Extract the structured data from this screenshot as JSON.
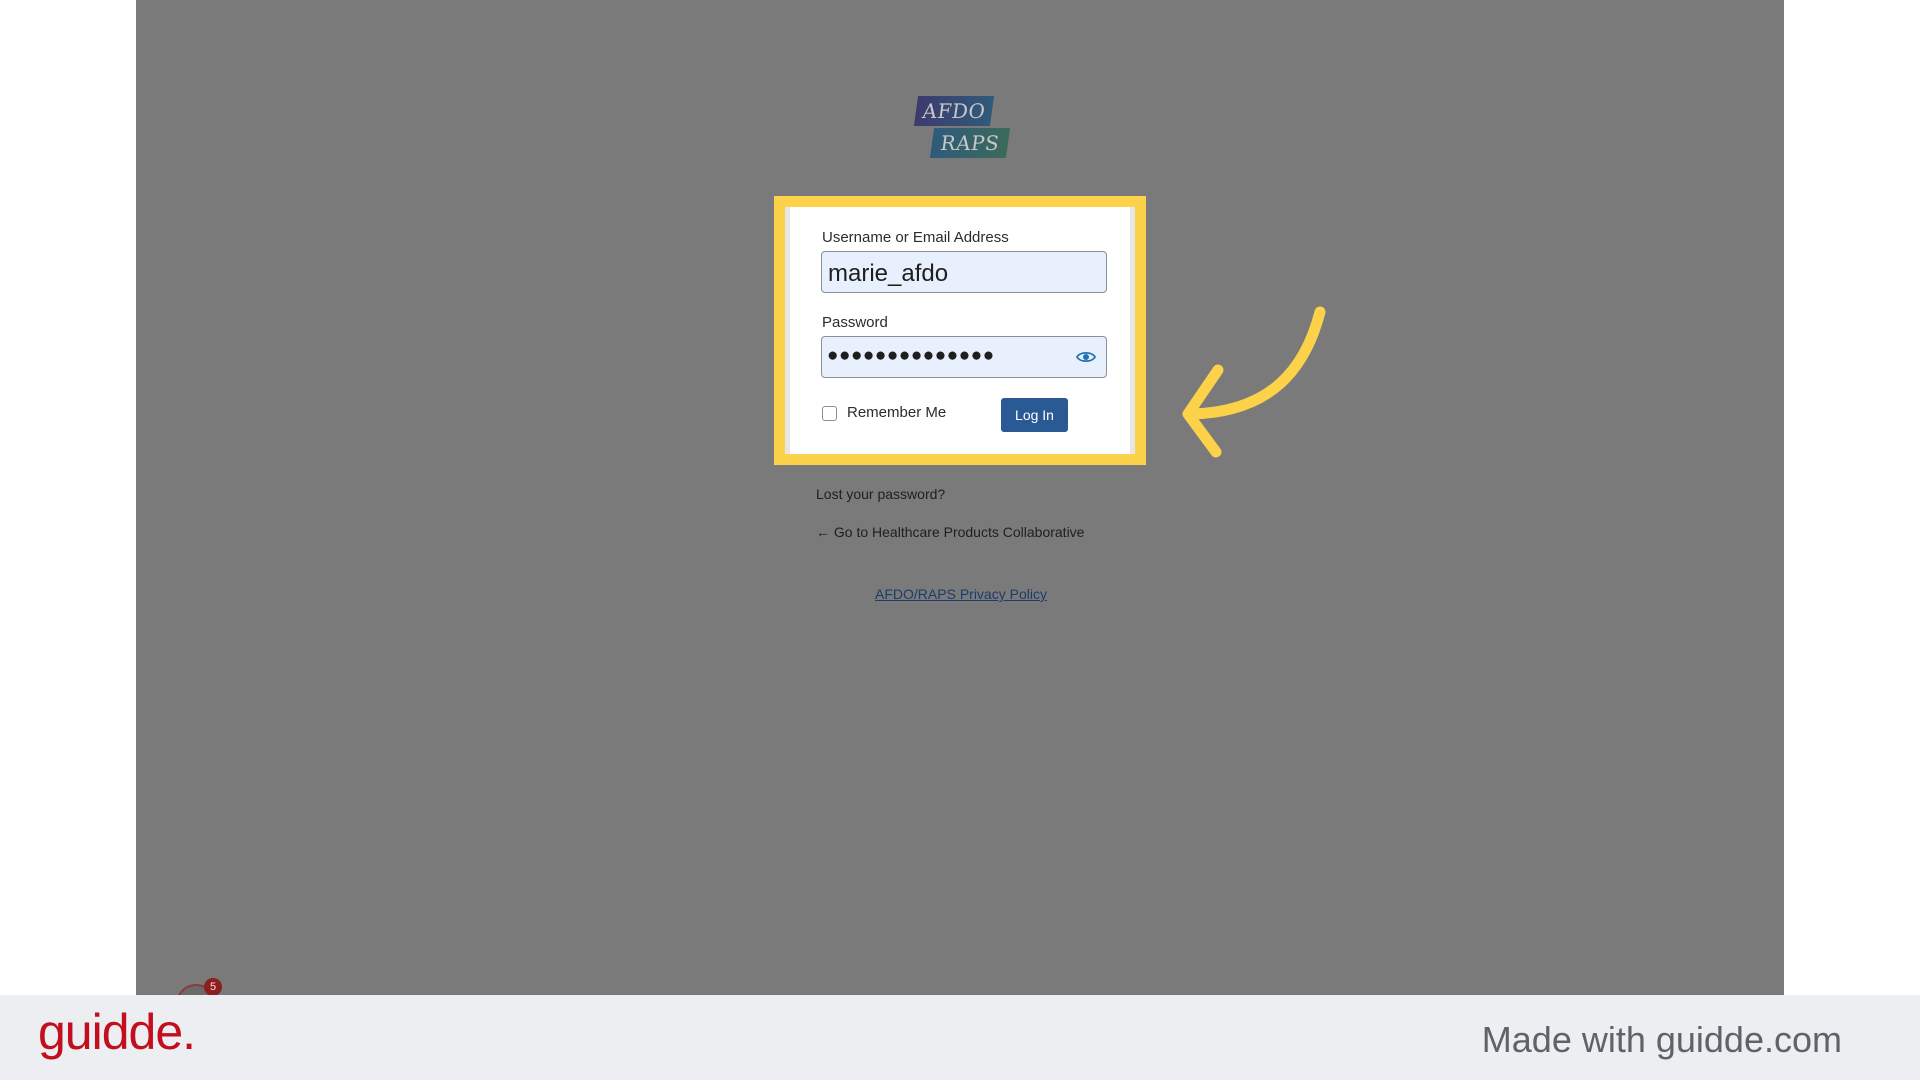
{
  "logo": {
    "line1": "AFDO",
    "line2": "RAPS"
  },
  "login_form": {
    "username_label": "Username or Email Address",
    "username_value": "marie_afdo",
    "password_label": "Password",
    "password_masked": "●●●●●●●●●●●●●●",
    "remember_label": "Remember Me",
    "remember_checked": false,
    "submit_label": "Log In"
  },
  "links": {
    "lost_password": "Lost your password?",
    "back_to_site": "← Go to Healthcare Products Collaborative",
    "privacy_policy": "AFDO/RAPS Privacy Policy"
  },
  "notification": {
    "badge_count": "5"
  },
  "footer": {
    "brand": "guidde.",
    "tagline": "Made with guidde.com"
  },
  "colors": {
    "highlight": "#fbd24a",
    "button": "#2a5a94",
    "brand": "#c30e1d",
    "overlay": "#7a7a7a"
  },
  "icons": {
    "password_toggle": "eye-icon",
    "annotation": "curved-arrow-icon"
  }
}
